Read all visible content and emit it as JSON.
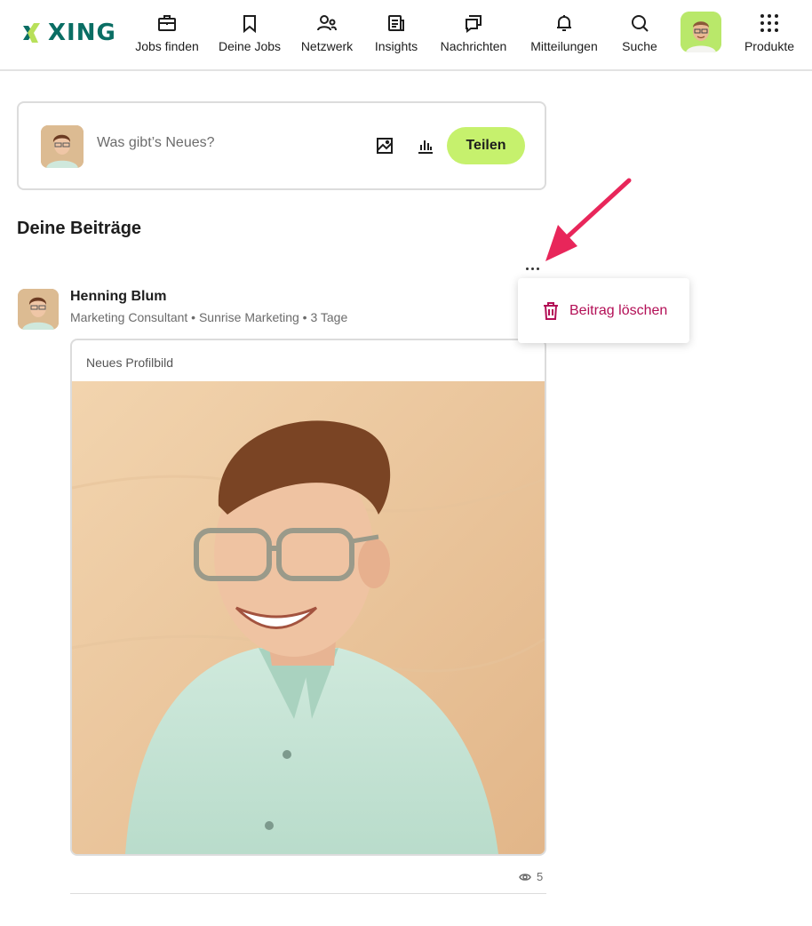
{
  "header": {
    "logo_text": "XING",
    "nav": [
      {
        "id": "jobs",
        "label": "Jobs finden",
        "icon": "briefcase-icon"
      },
      {
        "id": "myjobs",
        "label": "Deine Jobs",
        "icon": "bookmark-icon"
      },
      {
        "id": "network",
        "label": "Netzwerk",
        "icon": "people-icon"
      },
      {
        "id": "insights",
        "label": "Insights",
        "icon": "news-icon"
      },
      {
        "id": "messages",
        "label": "Nachrichten",
        "icon": "chat-icon"
      },
      {
        "id": "notifications",
        "label": "Mitteilungen",
        "icon": "bell-icon"
      },
      {
        "id": "search",
        "label": "Suche",
        "icon": "search-icon"
      },
      {
        "id": "products",
        "label": "Produkte",
        "icon": "grid-icon"
      }
    ]
  },
  "composer": {
    "placeholder": "Was gibt’s Neues?",
    "share_label": "Teilen"
  },
  "section_title": "Deine Beiträge",
  "post": {
    "author": "Henning Blum",
    "meta": "Marketing Consultant • Sunrise Marketing • 3 Tage",
    "caption": "Neues Profilbild",
    "views": "5"
  },
  "menu": {
    "delete_label": "Beitrag löschen"
  },
  "colors": {
    "brand": "#0a6e64",
    "accent": "#c6f16d",
    "danger": "#b30f56",
    "annotation": "#e8265a"
  }
}
